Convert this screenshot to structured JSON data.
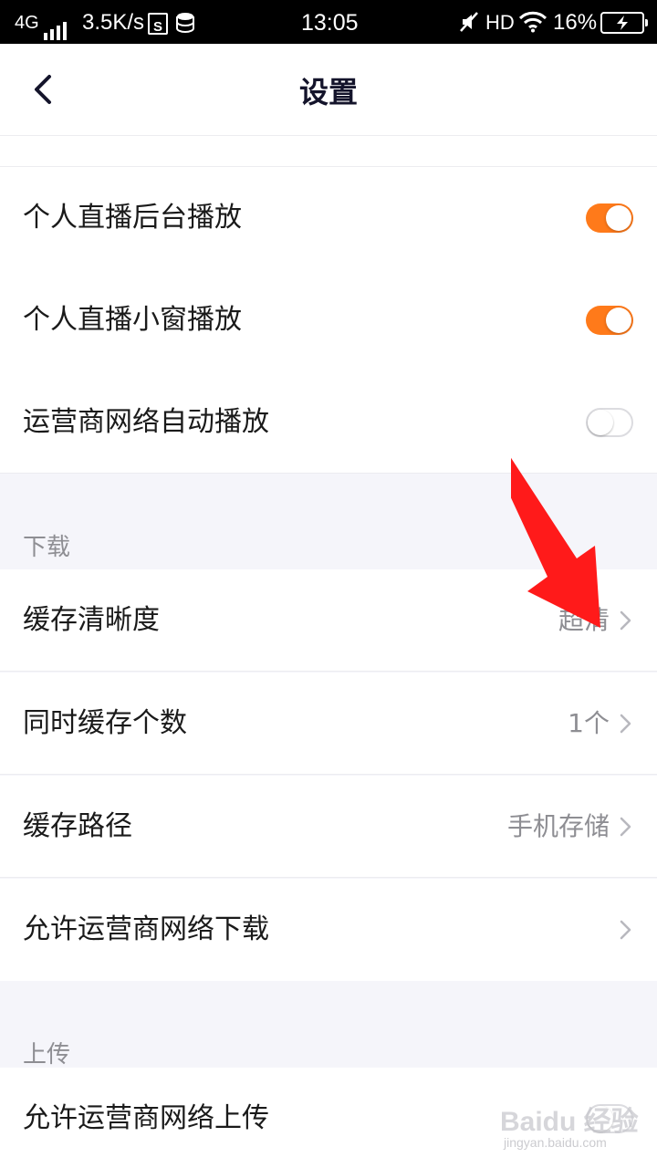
{
  "status_bar": {
    "network": "4G",
    "speed": "3.5K/s",
    "sim_badge": "S",
    "time": "13:05",
    "hd": "HD",
    "battery_percent": "16%"
  },
  "header": {
    "title": "设置"
  },
  "playback": {
    "items": [
      {
        "label": "个人直播后台播放",
        "toggle": true
      },
      {
        "label": "个人直播小窗播放",
        "toggle": true
      },
      {
        "label": "运营商网络自动播放",
        "toggle": false
      }
    ]
  },
  "download": {
    "title": "下载",
    "items": [
      {
        "label": "缓存清晰度",
        "value": "超清"
      },
      {
        "label": "同时缓存个数",
        "value": "1个"
      },
      {
        "label": "缓存路径",
        "value": "手机存储"
      },
      {
        "label": "允许运营商网络下载",
        "value": ""
      }
    ]
  },
  "upload": {
    "title": "上传",
    "items": [
      {
        "label": "允许运营商网络上传",
        "toggle": false
      }
    ]
  },
  "watermark": {
    "logo": "Baidu 经验",
    "url": "jingyan.baidu.com"
  },
  "colors": {
    "accent": "#ff7a1a",
    "annotation": "#ff1a1a"
  }
}
